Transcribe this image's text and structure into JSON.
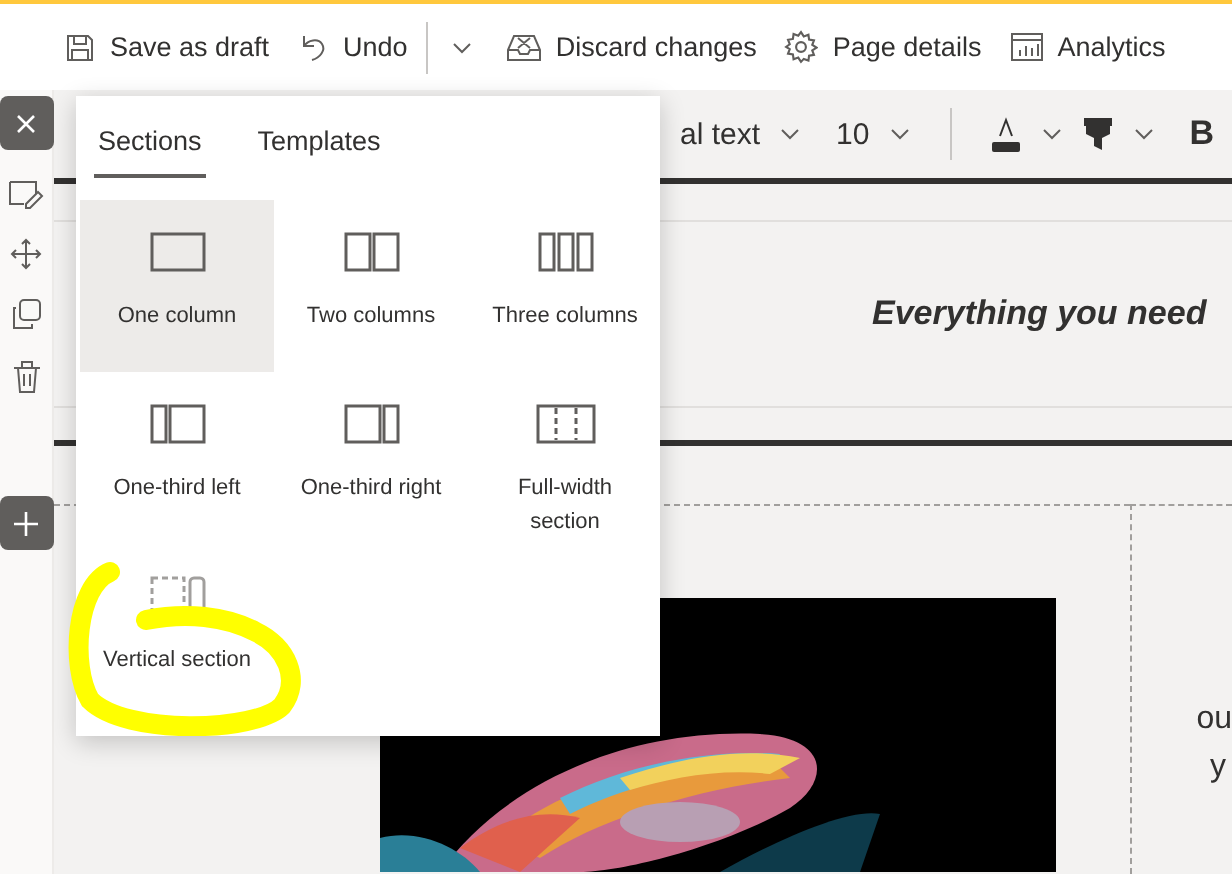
{
  "command_bar": [
    {
      "kind": "save",
      "label": "Save as draft"
    },
    {
      "kind": "undo",
      "label": "Undo"
    },
    {
      "kind": "more"
    },
    {
      "kind": "discard",
      "label": "Discard changes"
    },
    {
      "kind": "settings",
      "label": "Page details"
    },
    {
      "kind": "analytics",
      "label": "Analytics"
    }
  ],
  "rail": [
    {
      "kind": "close"
    },
    {
      "kind": "edit"
    },
    {
      "kind": "move"
    },
    {
      "kind": "duplicate"
    },
    {
      "kind": "delete"
    },
    {
      "kind": "add"
    }
  ],
  "format_toolbar": {
    "style": "al text",
    "size": "10",
    "bold": "B"
  },
  "heading": "Everything you need",
  "right_text": [
    "ou",
    "y"
  ],
  "panel": {
    "tabs": [
      {
        "label": "Sections",
        "selected": true
      },
      {
        "label": "Templates",
        "selected": false
      }
    ],
    "layouts": [
      {
        "kind": "one",
        "label": "One column",
        "selected": true
      },
      {
        "kind": "two",
        "label": "Two columns",
        "selected": false
      },
      {
        "kind": "three",
        "label": "Three columns",
        "selected": false
      },
      {
        "kind": "third-left",
        "label": "One-third left",
        "selected": false
      },
      {
        "kind": "third-right",
        "label": "One-third right",
        "selected": false
      },
      {
        "kind": "full",
        "label": "Full-width section",
        "selected": false
      },
      {
        "kind": "vertical",
        "label": "Vertical section",
        "selected": false
      }
    ]
  },
  "highlight": {
    "kind": "circle"
  }
}
